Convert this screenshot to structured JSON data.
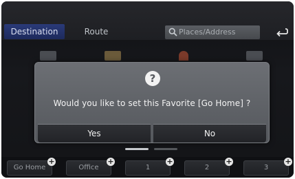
{
  "header": {
    "tabs": [
      {
        "label": "Destination",
        "active": true
      },
      {
        "label": "Route",
        "active": false
      }
    ],
    "search": {
      "placeholder": "Places/Address"
    },
    "back_icon": "back-arrow-icon"
  },
  "dialog": {
    "icon": "question-icon",
    "icon_glyph": "?",
    "message": "Would you like to set this Favorite [Go Home] ?",
    "buttons": {
      "yes": "Yes",
      "no": "No"
    }
  },
  "favorites": [
    {
      "label": "Go Home"
    },
    {
      "label": "Office"
    },
    {
      "label": "1"
    },
    {
      "label": "2"
    },
    {
      "label": "3"
    }
  ],
  "colors": {
    "active_tab": "#2a3a78",
    "dialog": "#626569",
    "button": "#26282c"
  }
}
